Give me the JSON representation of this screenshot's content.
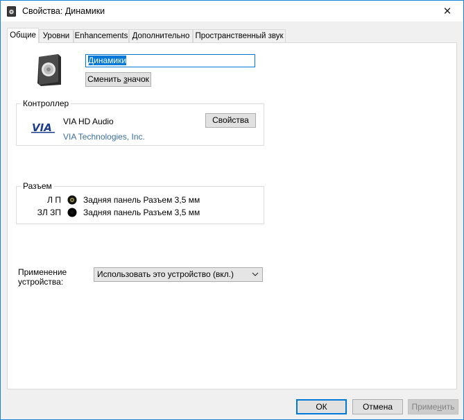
{
  "window": {
    "title": "Свойства: Динамики",
    "close_glyph": "✕"
  },
  "tabs": [
    {
      "label": "Общие",
      "active": true
    },
    {
      "label": "Уровни",
      "active": false
    },
    {
      "label": "Enhancements",
      "active": false
    },
    {
      "label": "Дополнительно",
      "active": false
    },
    {
      "label": "Пространственный звук",
      "active": false
    }
  ],
  "general": {
    "device_name": "Динамики",
    "change_icon_label_pre": "Сменить ",
    "change_icon_label_u": "з",
    "change_icon_label_post": "начок"
  },
  "controller": {
    "group_label": "Контроллер",
    "name": "VIA HD Audio",
    "vendor": "VIA Technologies, Inc.",
    "properties_button": "Свойства",
    "logo_text": "VIA"
  },
  "jack": {
    "group_label": "Разъем",
    "rows": [
      {
        "channels": "Л П",
        "description": "Задняя панель Разъем 3,5 мм",
        "color": "#6b6b2a"
      },
      {
        "channels": "ЗЛ ЗП",
        "description": "Задняя панель Разъем 3,5 мм",
        "color": "#000000"
      }
    ]
  },
  "usage": {
    "label_line1": "Применение",
    "label_line2": "устройства:",
    "selected": "Использовать это устройство (вкл.)"
  },
  "footer": {
    "ok": "ОК",
    "cancel": "Отмена",
    "apply_pre": "Приме",
    "apply_u": "н",
    "apply_post": "ить"
  },
  "colors": {
    "accent": "#0078d7",
    "vendor_link": "#3a6ea5"
  }
}
